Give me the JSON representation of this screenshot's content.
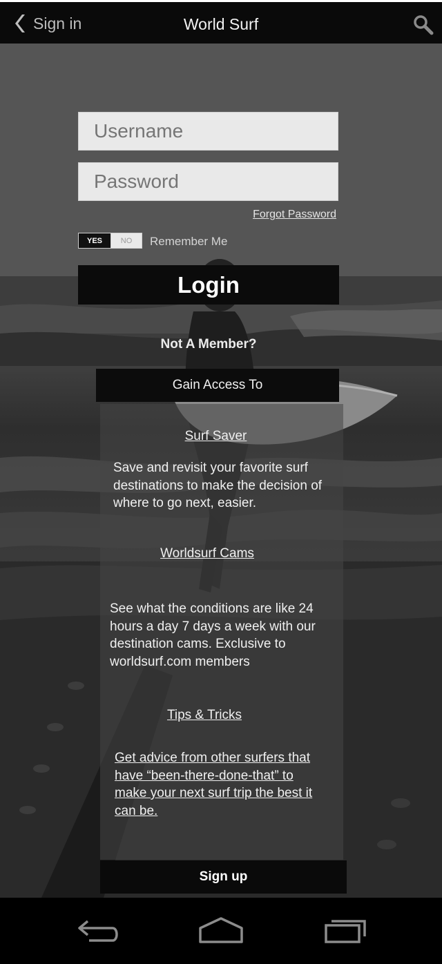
{
  "header": {
    "back_label": "Sign in",
    "title": "World Surf"
  },
  "login": {
    "username_placeholder": "Username",
    "password_placeholder": "Password",
    "forgot_password": "Forgot Password",
    "remember_toggle": {
      "yes": "YES",
      "no": "NO",
      "selected": "YES"
    },
    "remember_label": "Remember Me",
    "login_button": "Login"
  },
  "signup": {
    "not_member": "Not A Member?",
    "gain_access": "Gain Access To",
    "features": [
      {
        "title": "Surf Saver",
        "description": "Save and revisit your favorite surf destinations to make the decision of where to go next, easier."
      },
      {
        "title": "Worldsurf Cams",
        "description": "See what the conditions are like 24 hours a day 7 days a week with our destination cams. Exclusive to worldsurf.com members"
      },
      {
        "title": "Tips & Tricks",
        "description": "Get advice from other surfers that have “been-there-done-that” to make your next surf trip the best it can be."
      }
    ],
    "signup_button": "Sign up"
  },
  "icons": {
    "back": "chevron-left-icon",
    "search": "search-icon",
    "nav_back": "android-back-icon",
    "nav_home": "android-home-icon",
    "nav_recent": "android-recent-apps-icon"
  }
}
